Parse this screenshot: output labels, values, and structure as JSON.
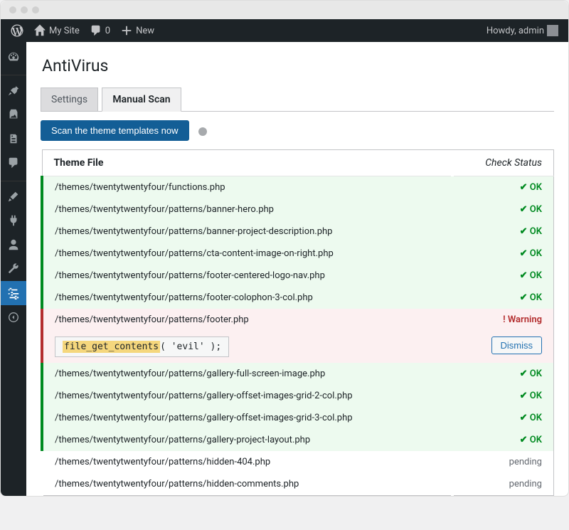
{
  "adminBar": {
    "siteName": "My Site",
    "commentCount": "0",
    "newLabel": "New",
    "greeting": "Howdy, admin"
  },
  "page": {
    "title": "AntiVirus"
  },
  "tabs": {
    "settings": "Settings",
    "manualScan": "Manual Scan"
  },
  "scan": {
    "buttonLabel": "Scan the theme templates now"
  },
  "table": {
    "colFile": "Theme File",
    "colStatus": "Check Status"
  },
  "statusLabels": {
    "ok": "✔ OK",
    "warning": "! Warning",
    "pending": "pending"
  },
  "warningDetail": {
    "highlighted": "file_get_contents",
    "rest": "( 'evil' );",
    "dismiss": "Dismiss"
  },
  "rows": [
    {
      "file": "/themes/twentytwentyfour/functions.php",
      "status": "ok"
    },
    {
      "file": "/themes/twentytwentyfour/patterns/banner-hero.php",
      "status": "ok"
    },
    {
      "file": "/themes/twentytwentyfour/patterns/banner-project-description.php",
      "status": "ok"
    },
    {
      "file": "/themes/twentytwentyfour/patterns/cta-content-image-on-right.php",
      "status": "ok"
    },
    {
      "file": "/themes/twentytwentyfour/patterns/footer-centered-logo-nav.php",
      "status": "ok"
    },
    {
      "file": "/themes/twentytwentyfour/patterns/footer-colophon-3-col.php",
      "status": "ok"
    },
    {
      "file": "/themes/twentytwentyfour/patterns/footer.php",
      "status": "warning"
    },
    {
      "file": "/themes/twentytwentyfour/patterns/gallery-full-screen-image.php",
      "status": "ok"
    },
    {
      "file": "/themes/twentytwentyfour/patterns/gallery-offset-images-grid-2-col.php",
      "status": "ok"
    },
    {
      "file": "/themes/twentytwentyfour/patterns/gallery-offset-images-grid-3-col.php",
      "status": "ok"
    },
    {
      "file": "/themes/twentytwentyfour/patterns/gallery-project-layout.php",
      "status": "ok"
    },
    {
      "file": "/themes/twentytwentyfour/patterns/hidden-404.php",
      "status": "pending"
    },
    {
      "file": "/themes/twentytwentyfour/patterns/hidden-comments.php",
      "status": "pending"
    }
  ]
}
